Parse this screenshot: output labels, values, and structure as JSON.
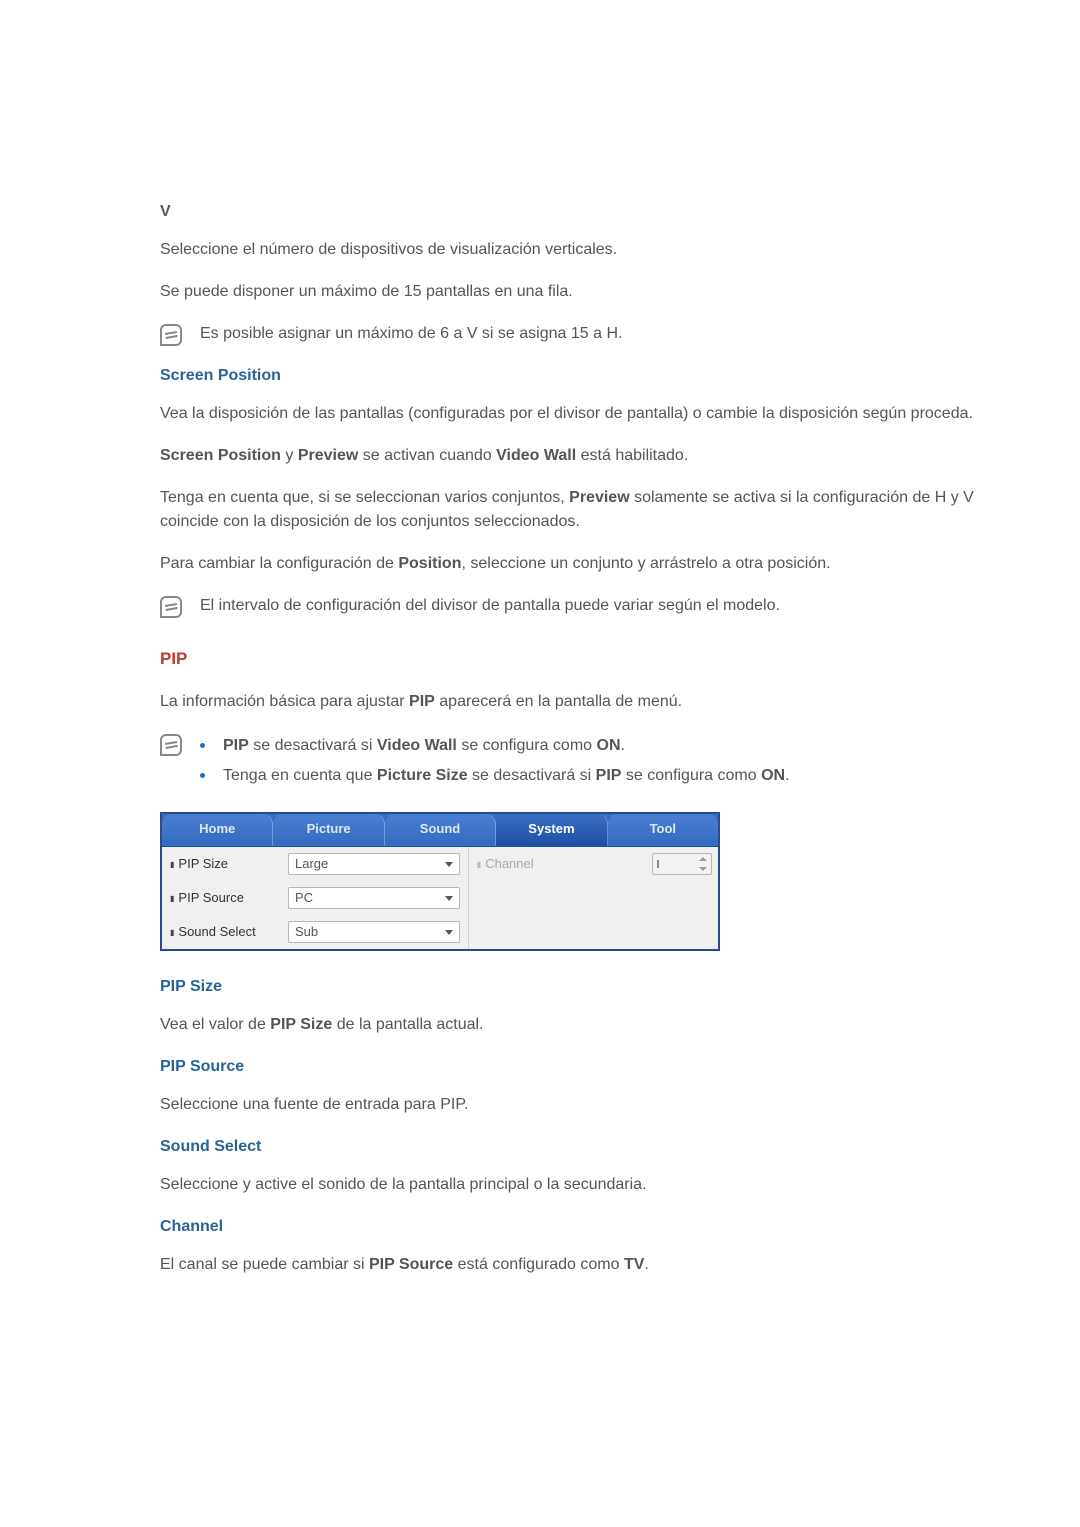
{
  "sections": {
    "v": {
      "heading": "V",
      "p1": "Seleccione el número de dispositivos de visualización verticales.",
      "p2": "Se puede disponer un máximo de 15 pantallas en una fila.",
      "note": "Es posible asignar un máximo de 6 a V si se asigna 15 a H."
    },
    "screenPosition": {
      "heading": "Screen Position",
      "p1": "Vea la disposición de las pantallas (configuradas por el divisor de pantalla) o cambie la disposición según proceda.",
      "p2_pre": "",
      "p2_b1": "Screen Position",
      "p2_mid1": " y ",
      "p2_b2": "Preview",
      "p2_mid2": " se activan cuando ",
      "p2_b3": "Video Wall",
      "p2_post": " está habilitado.",
      "p3_pre": "Tenga en cuenta que, si se seleccionan varios conjuntos, ",
      "p3_b1": "Preview",
      "p3_post": " solamente se activa si la configuración de H y V coincide con la disposición de los conjuntos seleccionados.",
      "p4_pre": "Para cambiar la configuración de ",
      "p4_b1": "Position",
      "p4_post": ", seleccione un conjunto y arrástrelo a otra posición.",
      "note": "El intervalo de configuración del divisor de pantalla puede variar según el modelo."
    },
    "pip": {
      "heading": "PIP",
      "intro_pre": "La información básica para ajustar ",
      "intro_b1": "PIP",
      "intro_post": " aparecerá en la pantalla de menú.",
      "bullet1_b1": "PIP",
      "bullet1_mid1": " se desactivará si ",
      "bullet1_b2": "Video Wall",
      "bullet1_mid2": " se configura como ",
      "bullet1_b3": "ON",
      "bullet1_post": ".",
      "bullet2_pre": "Tenga en cuenta que ",
      "bullet2_b1": "Picture Size",
      "bullet2_mid1": " se desactivará si ",
      "bullet2_b2": "PIP",
      "bullet2_mid2": " se configura como ",
      "bullet2_b3": "ON",
      "bullet2_post": "."
    },
    "pipSize": {
      "heading": "PIP Size",
      "p_pre": "Vea el valor de ",
      "p_b1": "PIP Size",
      "p_post": " de la pantalla actual."
    },
    "pipSource": {
      "heading": "PIP Source",
      "p": "Seleccione una fuente de entrada para PIP."
    },
    "soundSelect": {
      "heading": "Sound Select",
      "p": "Seleccione y active el sonido de la pantalla principal o la secundaria."
    },
    "channel": {
      "heading": "Channel",
      "p_pre": "El canal se puede cambiar si ",
      "p_b1": "PIP Source",
      "p_mid": " está configurado como ",
      "p_b2": "TV",
      "p_post": "."
    }
  },
  "uiPanel": {
    "tabs": {
      "home": "Home",
      "picture": "Picture",
      "sound": "Sound",
      "system": "System",
      "tool": "Tool"
    },
    "rows": {
      "pipSizeLabel": "PIP Size",
      "pipSizeValue": "Large",
      "pipSourceLabel": "PIP Source",
      "pipSourceValue": "PC",
      "soundSelectLabel": "Sound Select",
      "soundSelectValue": "Sub",
      "channelLabel": "Channel"
    },
    "activeTab": "System"
  },
  "colors": {
    "accentBlue": "#2a6496",
    "headingRed": "#c0392b",
    "tabBlue": "#1d4fa3"
  }
}
